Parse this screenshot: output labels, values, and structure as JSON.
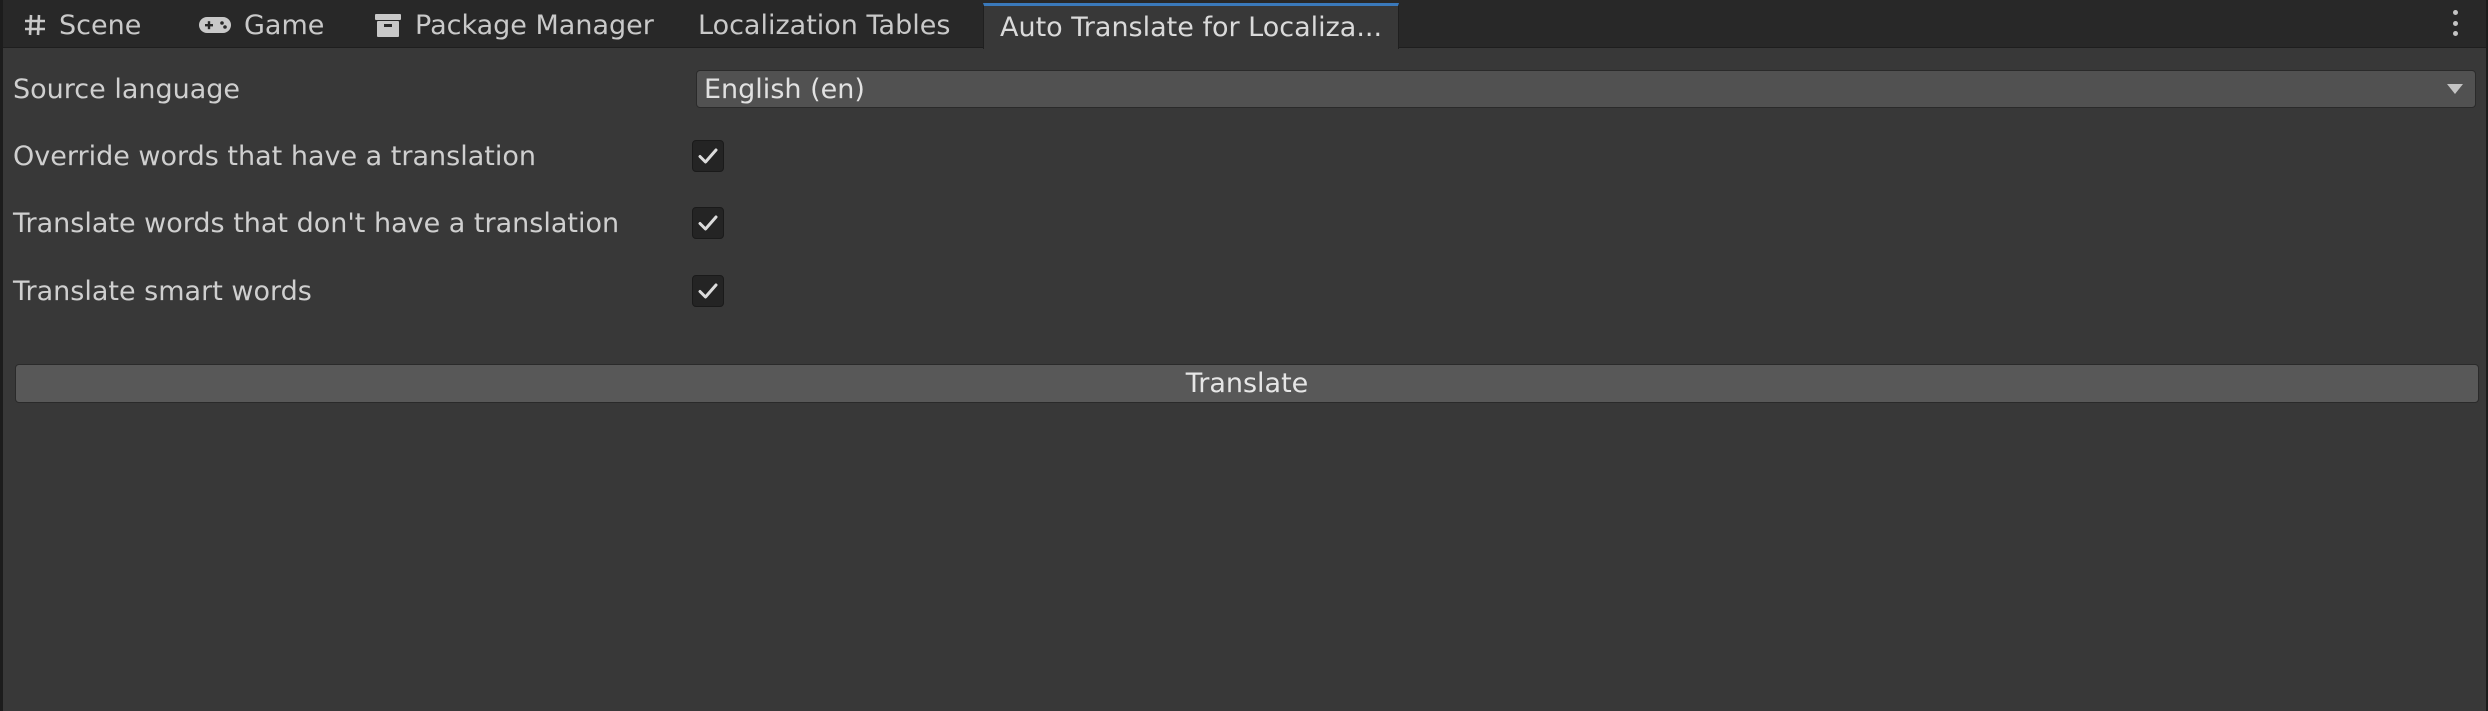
{
  "tabs": [
    {
      "label": "Scene",
      "icon": "hash-grid-icon"
    },
    {
      "label": "Game",
      "icon": "gamepad-icon"
    },
    {
      "label": "Package Manager",
      "icon": "package-box-icon"
    },
    {
      "label": "Localization Tables",
      "icon": ""
    },
    {
      "label": "Auto Translate for Localiza...",
      "icon": "",
      "active": true
    }
  ],
  "menu": {
    "icon": "kebab-menu-icon"
  },
  "form": {
    "source_language": {
      "label": "Source language",
      "value": "English (en)"
    },
    "override_words": {
      "label": "Override words that have a translation",
      "checked": true
    },
    "translate_missing": {
      "label": "Translate words that don't have a translation",
      "checked": true
    },
    "translate_smart": {
      "label": "Translate smart words",
      "checked": true
    }
  },
  "translate_button": {
    "label": "Translate"
  },
  "colors": {
    "background": "#383838",
    "tabbar": "#282828",
    "active_tab_accent": "#3a79bb",
    "button": "#585858",
    "field": "#515151"
  }
}
